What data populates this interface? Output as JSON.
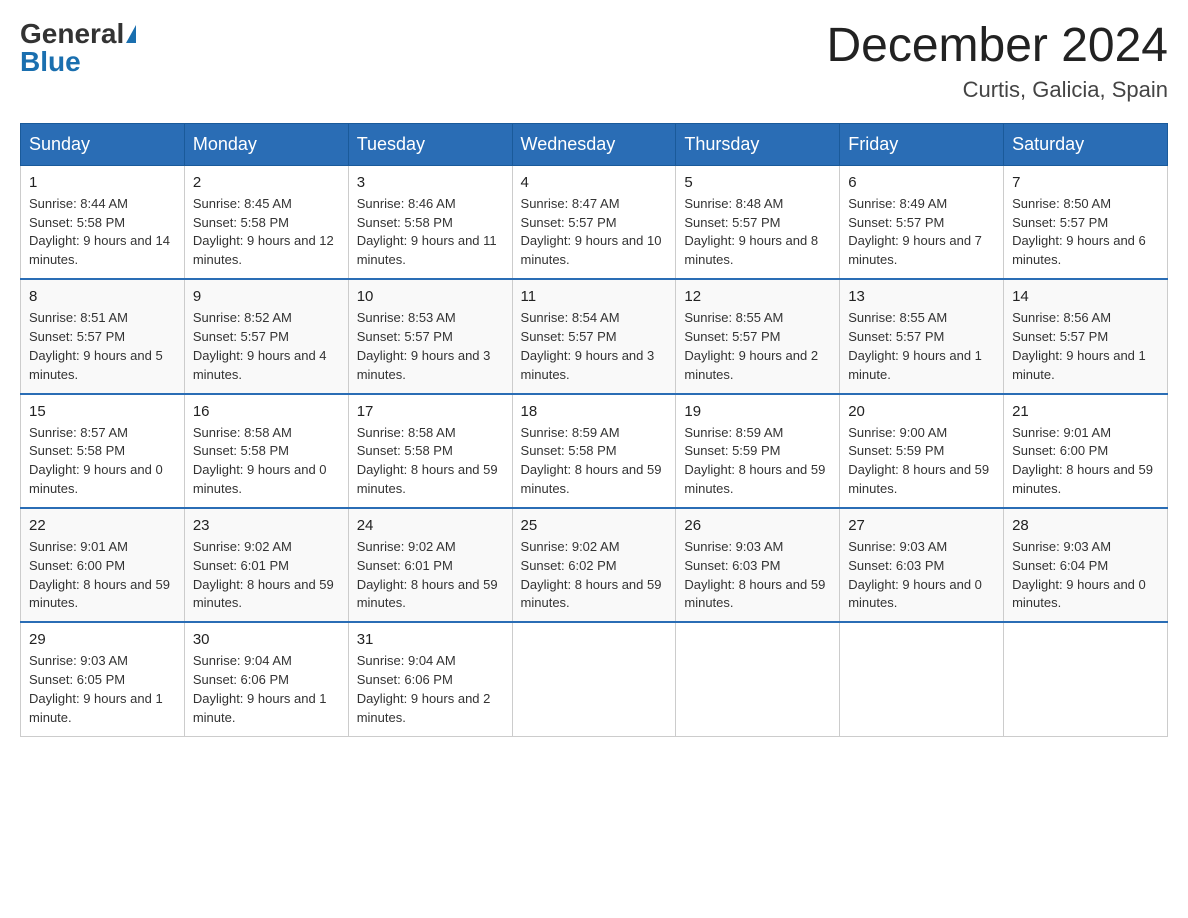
{
  "header": {
    "logo_general": "General",
    "logo_blue": "Blue",
    "month_title": "December 2024",
    "location": "Curtis, Galicia, Spain"
  },
  "days_of_week": [
    "Sunday",
    "Monday",
    "Tuesday",
    "Wednesday",
    "Thursday",
    "Friday",
    "Saturday"
  ],
  "weeks": [
    [
      {
        "day": "1",
        "sunrise": "8:44 AM",
        "sunset": "5:58 PM",
        "daylight": "9 hours and 14 minutes."
      },
      {
        "day": "2",
        "sunrise": "8:45 AM",
        "sunset": "5:58 PM",
        "daylight": "9 hours and 12 minutes."
      },
      {
        "day": "3",
        "sunrise": "8:46 AM",
        "sunset": "5:58 PM",
        "daylight": "9 hours and 11 minutes."
      },
      {
        "day": "4",
        "sunrise": "8:47 AM",
        "sunset": "5:57 PM",
        "daylight": "9 hours and 10 minutes."
      },
      {
        "day": "5",
        "sunrise": "8:48 AM",
        "sunset": "5:57 PM",
        "daylight": "9 hours and 8 minutes."
      },
      {
        "day": "6",
        "sunrise": "8:49 AM",
        "sunset": "5:57 PM",
        "daylight": "9 hours and 7 minutes."
      },
      {
        "day": "7",
        "sunrise": "8:50 AM",
        "sunset": "5:57 PM",
        "daylight": "9 hours and 6 minutes."
      }
    ],
    [
      {
        "day": "8",
        "sunrise": "8:51 AM",
        "sunset": "5:57 PM",
        "daylight": "9 hours and 5 minutes."
      },
      {
        "day": "9",
        "sunrise": "8:52 AM",
        "sunset": "5:57 PM",
        "daylight": "9 hours and 4 minutes."
      },
      {
        "day": "10",
        "sunrise": "8:53 AM",
        "sunset": "5:57 PM",
        "daylight": "9 hours and 3 minutes."
      },
      {
        "day": "11",
        "sunrise": "8:54 AM",
        "sunset": "5:57 PM",
        "daylight": "9 hours and 3 minutes."
      },
      {
        "day": "12",
        "sunrise": "8:55 AM",
        "sunset": "5:57 PM",
        "daylight": "9 hours and 2 minutes."
      },
      {
        "day": "13",
        "sunrise": "8:55 AM",
        "sunset": "5:57 PM",
        "daylight": "9 hours and 1 minute."
      },
      {
        "day": "14",
        "sunrise": "8:56 AM",
        "sunset": "5:57 PM",
        "daylight": "9 hours and 1 minute."
      }
    ],
    [
      {
        "day": "15",
        "sunrise": "8:57 AM",
        "sunset": "5:58 PM",
        "daylight": "9 hours and 0 minutes."
      },
      {
        "day": "16",
        "sunrise": "8:58 AM",
        "sunset": "5:58 PM",
        "daylight": "9 hours and 0 minutes."
      },
      {
        "day": "17",
        "sunrise": "8:58 AM",
        "sunset": "5:58 PM",
        "daylight": "8 hours and 59 minutes."
      },
      {
        "day": "18",
        "sunrise": "8:59 AM",
        "sunset": "5:58 PM",
        "daylight": "8 hours and 59 minutes."
      },
      {
        "day": "19",
        "sunrise": "8:59 AM",
        "sunset": "5:59 PM",
        "daylight": "8 hours and 59 minutes."
      },
      {
        "day": "20",
        "sunrise": "9:00 AM",
        "sunset": "5:59 PM",
        "daylight": "8 hours and 59 minutes."
      },
      {
        "day": "21",
        "sunrise": "9:01 AM",
        "sunset": "6:00 PM",
        "daylight": "8 hours and 59 minutes."
      }
    ],
    [
      {
        "day": "22",
        "sunrise": "9:01 AM",
        "sunset": "6:00 PM",
        "daylight": "8 hours and 59 minutes."
      },
      {
        "day": "23",
        "sunrise": "9:02 AM",
        "sunset": "6:01 PM",
        "daylight": "8 hours and 59 minutes."
      },
      {
        "day": "24",
        "sunrise": "9:02 AM",
        "sunset": "6:01 PM",
        "daylight": "8 hours and 59 minutes."
      },
      {
        "day": "25",
        "sunrise": "9:02 AM",
        "sunset": "6:02 PM",
        "daylight": "8 hours and 59 minutes."
      },
      {
        "day": "26",
        "sunrise": "9:03 AM",
        "sunset": "6:03 PM",
        "daylight": "8 hours and 59 minutes."
      },
      {
        "day": "27",
        "sunrise": "9:03 AM",
        "sunset": "6:03 PM",
        "daylight": "9 hours and 0 minutes."
      },
      {
        "day": "28",
        "sunrise": "9:03 AM",
        "sunset": "6:04 PM",
        "daylight": "9 hours and 0 minutes."
      }
    ],
    [
      {
        "day": "29",
        "sunrise": "9:03 AM",
        "sunset": "6:05 PM",
        "daylight": "9 hours and 1 minute."
      },
      {
        "day": "30",
        "sunrise": "9:04 AM",
        "sunset": "6:06 PM",
        "daylight": "9 hours and 1 minute."
      },
      {
        "day": "31",
        "sunrise": "9:04 AM",
        "sunset": "6:06 PM",
        "daylight": "9 hours and 2 minutes."
      },
      null,
      null,
      null,
      null
    ]
  ]
}
